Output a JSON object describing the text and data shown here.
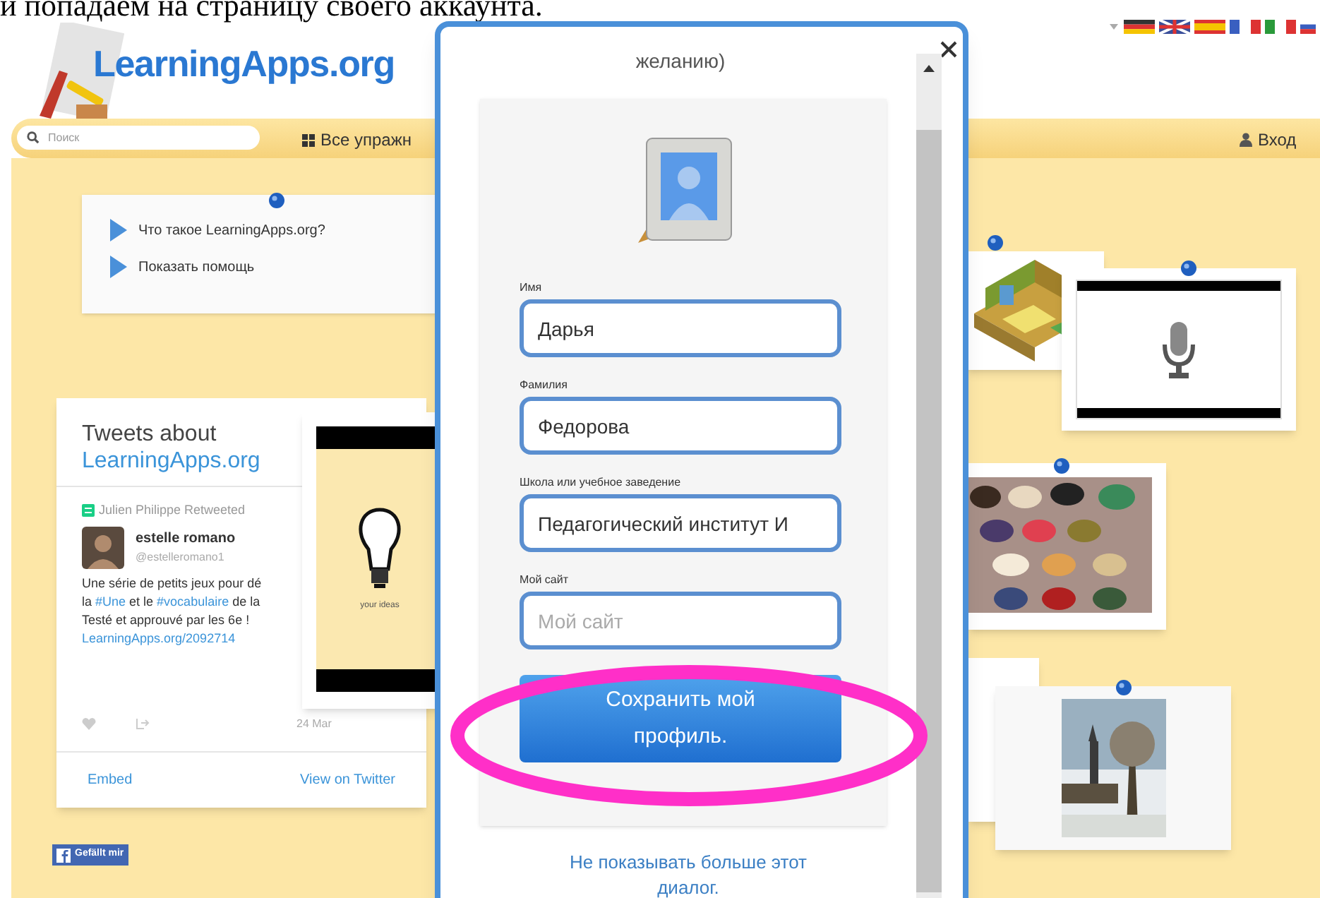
{
  "doc_caption": "и попадаем на страницу своего аккаунта.",
  "header": {
    "logo": "LearningApps.org",
    "search": {
      "placeholder": "Поиск"
    },
    "nav_item": "Все упражн",
    "login": "Вход"
  },
  "help_items": [
    "Что такое LearningApps.org?",
    "Показать помощь"
  ],
  "tweets": {
    "title": "Tweets about",
    "title_link": "LearningApps.org",
    "retweeted_by": "Julien Philippe Retweeted",
    "author_name": "estelle romano",
    "author_handle": "@estelleromano1",
    "lines": [
      [
        {
          "kind": "text",
          "text": "Une série de petits jeux pour dé"
        }
      ],
      [
        {
          "kind": "text",
          "text": "la "
        },
        {
          "kind": "link",
          "text": "#Une"
        },
        {
          "kind": "text",
          "text": " et le "
        },
        {
          "kind": "link",
          "text": "#vocabulaire"
        },
        {
          "kind": "text",
          "text": " de la"
        }
      ],
      [
        {
          "kind": "text",
          "text": "Testé et approuvé par les 6e !"
        }
      ],
      [
        {
          "kind": "link",
          "text": "LearningApps.org/2092714"
        }
      ]
    ],
    "date": "24 Mar",
    "embed": "Embed",
    "view": "View on Twitter"
  },
  "bulb_caption": "your ideas",
  "facebook": "Gefällt mir",
  "dialog": {
    "heading": "желанию)",
    "fields": [
      {
        "label": "Имя",
        "value": "Дарья"
      },
      {
        "label": "Фамилия",
        "value": "Федорова"
      },
      {
        "label": "Школа или учебное заведение",
        "value": "Педагогический институт И"
      },
      {
        "label": "Мой сайт",
        "placeholder": "Мой сайт"
      }
    ],
    "save_button": "Сохранить мой профиль.",
    "dismiss_link": "Не показывать больше этот диалог."
  }
}
